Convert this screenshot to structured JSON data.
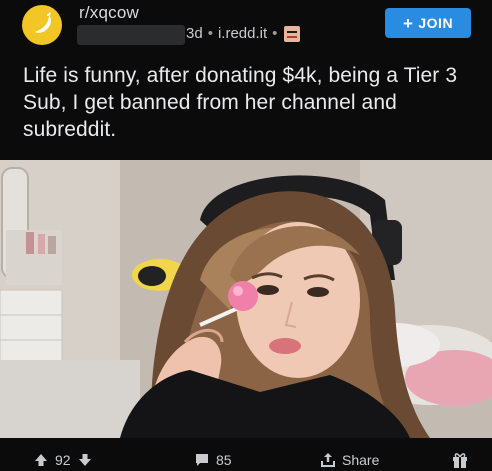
{
  "header": {
    "subreddit": "r/xqcow",
    "age": "3d",
    "separator": "•",
    "domain": "i.redd.it",
    "join_label": "JOIN",
    "join_plus": "+"
  },
  "post": {
    "title": "Life is funny, after donating $4k, being a Tier 3 Sub, I get banned from her channel and subreddit."
  },
  "actions": {
    "votes": "92",
    "comments": "85",
    "share_label": "Share"
  },
  "icons": {
    "avatar": "banana-icon",
    "flair": "face-emoji-icon",
    "upvote": "arrow-up-icon",
    "downvote": "arrow-down-icon",
    "comments": "comment-icon",
    "share": "share-icon",
    "award": "gift-icon"
  },
  "colors": {
    "background": "#0b0b0c",
    "join_button": "#2a8ce0",
    "text": "#e9eaeb"
  }
}
